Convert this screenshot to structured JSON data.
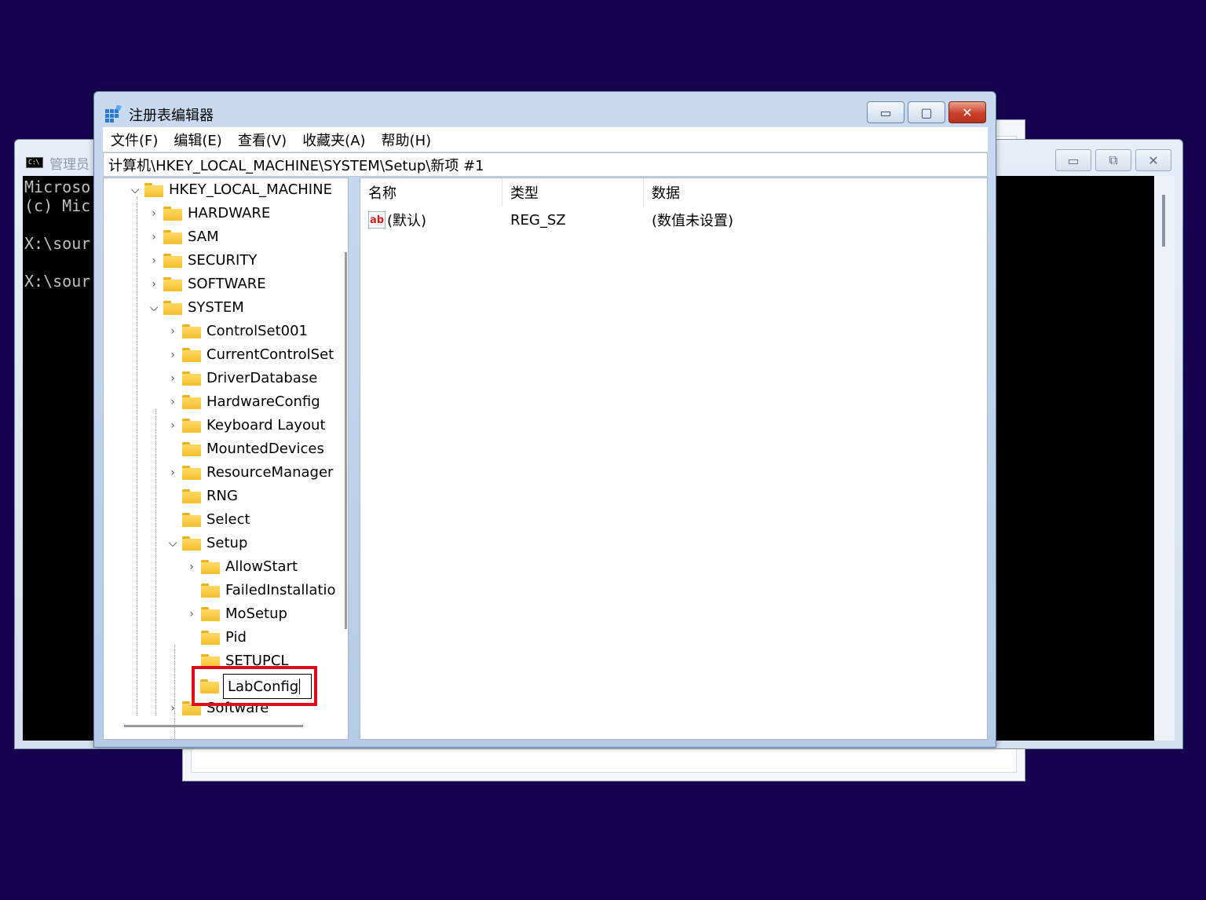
{
  "console": {
    "window_title": "管理员",
    "lines": [
      "Microso",
      "(c) Mic",
      "",
      "X:\\sour",
      "",
      "X:\\sour"
    ]
  },
  "regedit": {
    "title": "注册表编辑器",
    "menu": [
      "文件(F)",
      "编辑(E)",
      "查看(V)",
      "收藏夹(A)",
      "帮助(H)"
    ],
    "address": "计算机\\HKEY_LOCAL_MACHINE\\SYSTEM\\Setup\\新项 #1",
    "tree": {
      "root": "HKEY_LOCAL_MACHINE",
      "level1": [
        "HARDWARE",
        "SAM",
        "SECURITY",
        "SOFTWARE",
        "SYSTEM"
      ],
      "system_children": [
        "ControlSet001",
        "CurrentControlSet",
        "DriverDatabase",
        "HardwareConfig",
        "Keyboard Layout",
        "MountedDevices",
        "ResourceManager",
        "RNG",
        "Select",
        "Setup"
      ],
      "setup_children": [
        "AllowStart",
        "FailedInstallatio",
        "MoSetup",
        "Pid",
        "SETUPCL"
      ],
      "editing_key": "LabConfig",
      "after_setup": "Software"
    },
    "list": {
      "headers": [
        "名称",
        "类型",
        "数据"
      ],
      "rows": [
        {
          "name": "(默认)",
          "type": "REG_SZ",
          "data": "(数值未设置)"
        }
      ]
    }
  },
  "colors": {
    "desktop": "#16044f",
    "highlight_box": "#e0101a",
    "folder": "#f5bf2c"
  }
}
